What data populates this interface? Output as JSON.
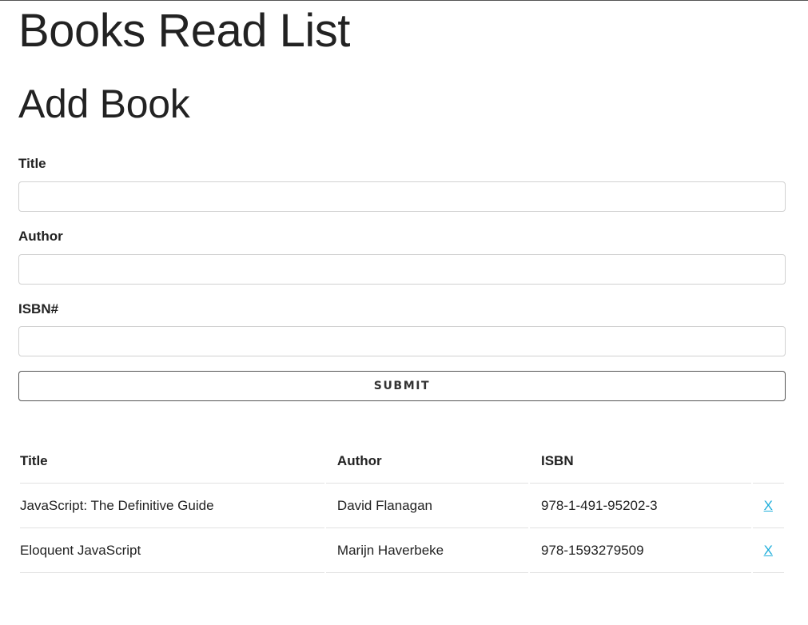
{
  "page": {
    "title": "Books Read List"
  },
  "form": {
    "heading": "Add Book",
    "fields": [
      {
        "label": "Title",
        "value": "",
        "placeholder": ""
      },
      {
        "label": "Author",
        "value": "",
        "placeholder": ""
      },
      {
        "label": "ISBN#",
        "value": "",
        "placeholder": ""
      }
    ],
    "submit_label": "SUBMIT"
  },
  "table": {
    "headers": [
      "Title",
      "Author",
      "ISBN",
      ""
    ],
    "rows": [
      {
        "title": "JavaScript: The Definitive Guide",
        "author": "David Flanagan",
        "isbn": "978-1-491-95202-3",
        "action": "X"
      },
      {
        "title": "Eloquent JavaScript",
        "author": "Marijn Haverbeke",
        "isbn": "978-1593279509",
        "action": "X"
      }
    ]
  },
  "colors": {
    "text": "#222222",
    "link": "#1eaedb",
    "input_border": "#d1d1d1",
    "button_border": "#555555"
  }
}
